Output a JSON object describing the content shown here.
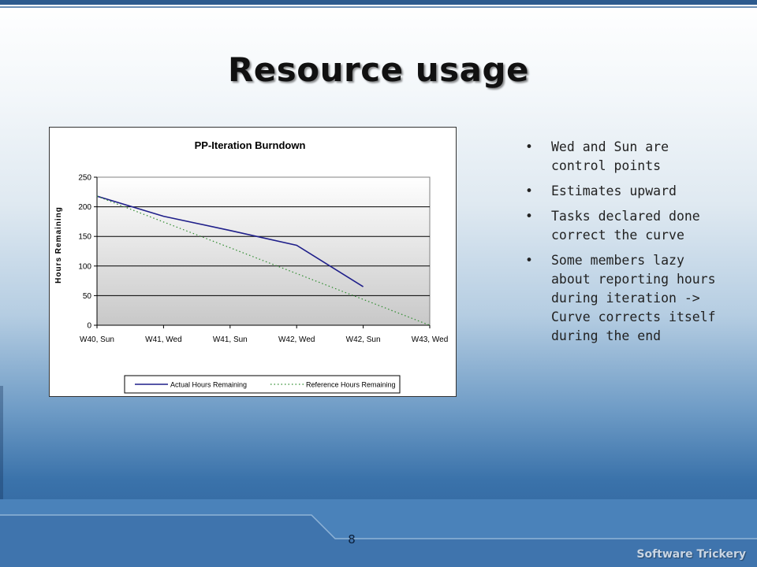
{
  "slide": {
    "title": "Resource usage",
    "page_number": "8",
    "brand": "Software Trickery"
  },
  "bullets": [
    "Wed and Sun are control points",
    "Estimates upward",
    "Tasks declared done correct the curve",
    "Some members lazy about reporting hours during iteration -> Curve corrects itself during the end"
  ],
  "chart_data": {
    "type": "line",
    "title": "PP-Iteration Burndown",
    "xlabel": "",
    "ylabel": "Hours Remaining",
    "categories": [
      "W40, Sun",
      "W41, Wed",
      "W41, Sun",
      "W42, Wed",
      "W42, Sun",
      "W43, Wed"
    ],
    "ylim": [
      0,
      250
    ],
    "yticks": [
      0,
      50,
      100,
      150,
      200,
      250
    ],
    "grid": true,
    "legend": "bottom",
    "series": [
      {
        "name": "Actual Hours Remaining",
        "values": [
          218,
          184,
          160,
          135,
          65,
          null
        ],
        "color": "#1f1f8a",
        "style": "solid"
      },
      {
        "name": "Reference Hours Remaining",
        "values": [
          218,
          174.4,
          130.8,
          87.2,
          43.6,
          0
        ],
        "color": "#2e8b2e",
        "style": "dotted"
      }
    ]
  }
}
